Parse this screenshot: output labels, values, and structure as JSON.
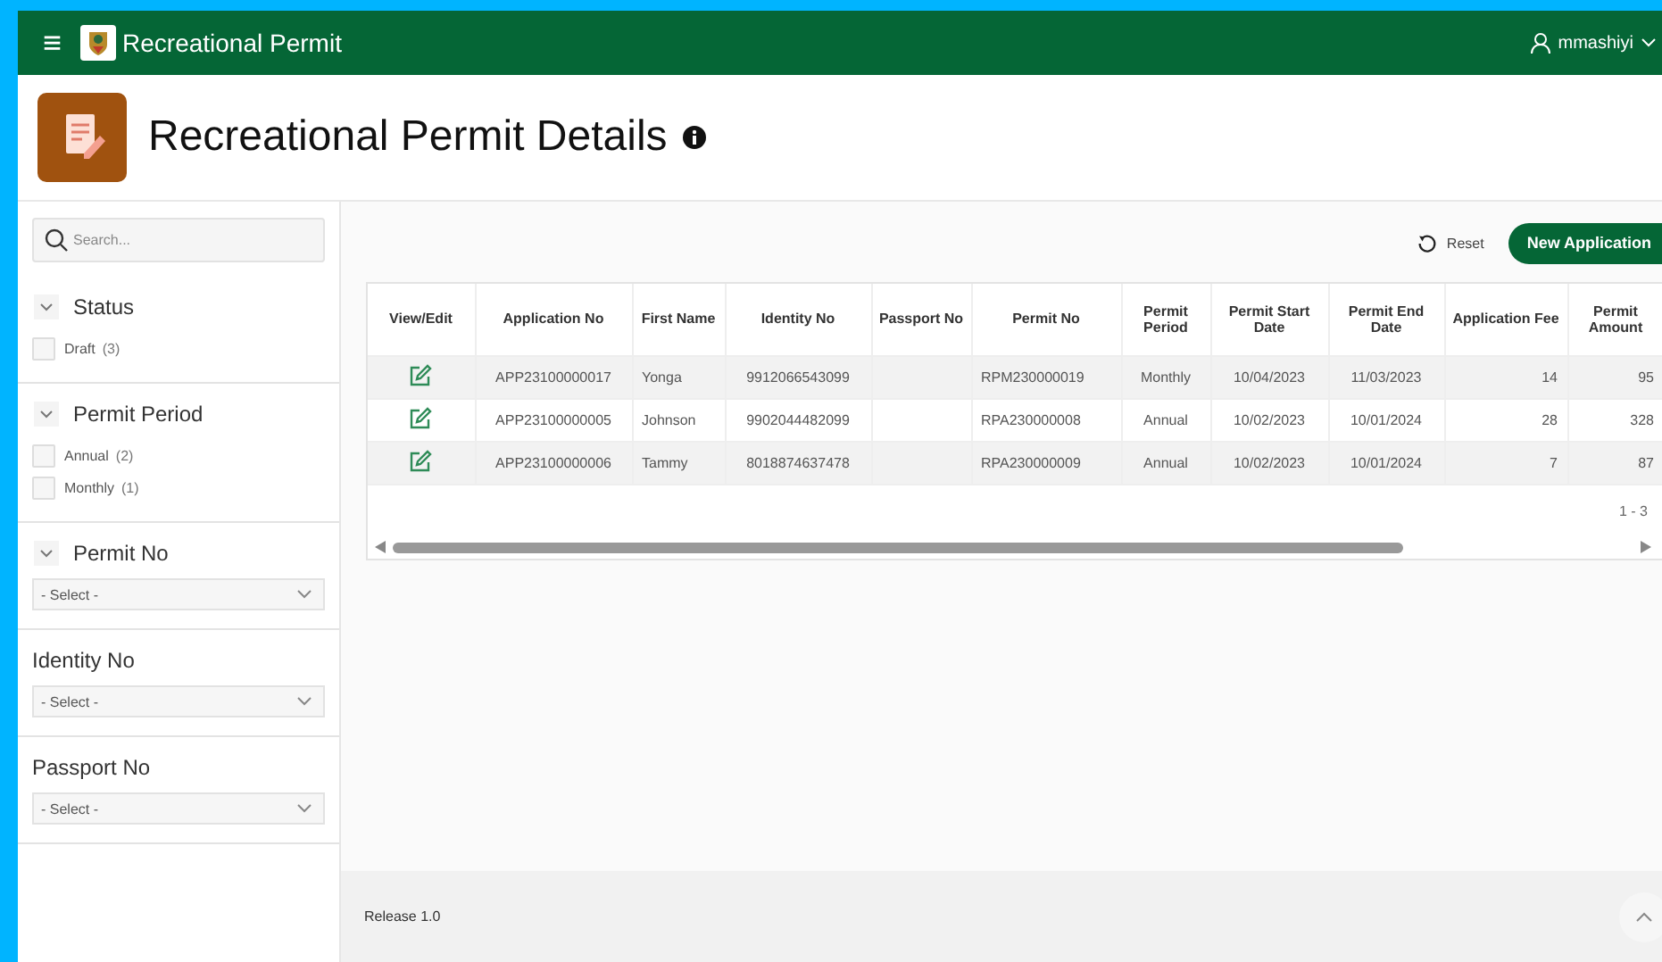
{
  "header": {
    "menu_icon": "≡",
    "app_title": "Recreational Permit",
    "user": "mmashiyi"
  },
  "page": {
    "title": "Recreational Permit Details"
  },
  "sidebar": {
    "search": {
      "placeholder": "Search..."
    },
    "facets": [
      {
        "kind": "checkbox",
        "label": "Status",
        "expanded": true,
        "options": [
          {
            "label": "Draft",
            "count": "(3)",
            "checked": false
          }
        ]
      },
      {
        "kind": "checkbox",
        "label": "Permit Period",
        "expanded": true,
        "options": [
          {
            "label": "Annual",
            "count": "(2)",
            "checked": false
          },
          {
            "label": "Monthly",
            "count": "(1)",
            "checked": false
          }
        ]
      },
      {
        "kind": "select",
        "label": "Permit No",
        "expanded": true,
        "value": "- Select -"
      },
      {
        "kind": "select",
        "label": "Identity No",
        "value": "- Select -"
      },
      {
        "kind": "select",
        "label": "Passport No",
        "value": "- Select -"
      }
    ]
  },
  "toolbar": {
    "reset": "Reset",
    "new_button": "New Application"
  },
  "table": {
    "columns": [
      "View/Edit",
      "Application No",
      "First Name",
      "Identity No",
      "Passport No",
      "Permit No",
      "Permit Period",
      "Permit Start Date",
      "Permit End Date",
      "Application Fee",
      "Permit Amount"
    ],
    "rows": [
      [
        "",
        "APP23100000017",
        "Yonga",
        "9912066543099",
        "",
        "RPM230000019",
        "Monthly",
        "10/04/2023",
        "11/03/2023",
        "14",
        "95"
      ],
      [
        "",
        "APP23100000005",
        "Johnson",
        "9902044482099",
        "",
        "RPA230000008",
        "Annual",
        "10/02/2023",
        "10/01/2024",
        "28",
        "328"
      ],
      [
        "",
        "APP23100000006",
        "Tammy",
        "8018874637478",
        "",
        "RPA230000009",
        "Annual",
        "10/02/2023",
        "10/01/2024",
        "7",
        "87"
      ]
    ],
    "pagination": "1 - 3"
  },
  "footer": {
    "release": "Release 1.0"
  }
}
